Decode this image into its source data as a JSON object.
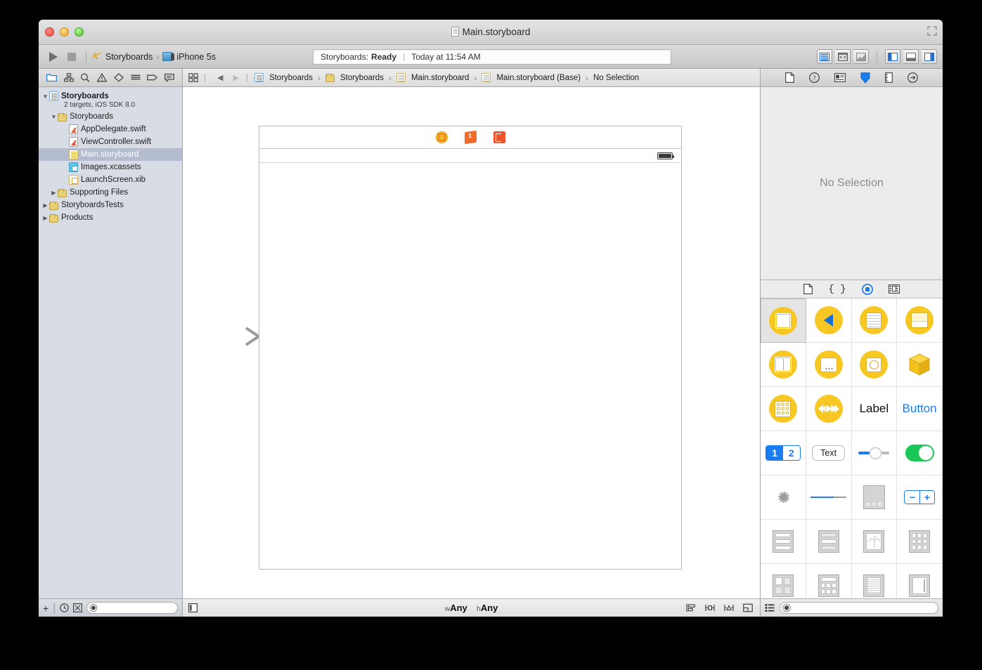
{
  "window": {
    "title": "Main.storyboard",
    "title_icon": "storyboard-file-icon"
  },
  "toolbar": {
    "run_label": "Run",
    "stop_label": "Stop",
    "scheme": {
      "project_name": "Storyboards",
      "destination": "iPhone 5s",
      "separator": "›"
    },
    "status": {
      "prefix": "Storyboards:",
      "state": "Ready",
      "divider": "|",
      "time": "Today at 11:54 AM"
    },
    "editor_buttons": [
      "standard-editor",
      "assistant-editor",
      "version-editor"
    ],
    "view_buttons": [
      "toggle-navigator",
      "toggle-debug-area",
      "toggle-utilities"
    ]
  },
  "navigator": {
    "tabs": [
      "project-navigator",
      "symbol-navigator",
      "find-navigator",
      "issue-navigator",
      "test-navigator",
      "debug-navigator",
      "breakpoint-navigator",
      "report-navigator"
    ],
    "tree": [
      {
        "label": "Storyboards",
        "sublabel": "2 targets, iOS SDK 8.0",
        "icon": "project-icon",
        "indent": 0,
        "disclosure": "open",
        "bold": true,
        "selected": false
      },
      {
        "label": "Storyboards",
        "icon": "folder-icon",
        "indent": 1,
        "disclosure": "open",
        "bold": false,
        "selected": false
      },
      {
        "label": "AppDelegate.swift",
        "icon": "swift-file-icon",
        "indent": 2,
        "disclosure": "none",
        "bold": false,
        "selected": false
      },
      {
        "label": "ViewController.swift",
        "icon": "swift-file-icon",
        "indent": 2,
        "disclosure": "none",
        "bold": false,
        "selected": false
      },
      {
        "label": "Main.storyboard",
        "icon": "storyboard-file-icon",
        "indent": 2,
        "disclosure": "none",
        "bold": false,
        "selected": true
      },
      {
        "label": "Images.xcassets",
        "icon": "assets-icon",
        "indent": 2,
        "disclosure": "none",
        "bold": false,
        "selected": false
      },
      {
        "label": "LaunchScreen.xib",
        "icon": "xib-file-icon",
        "indent": 2,
        "disclosure": "none",
        "bold": false,
        "selected": false
      },
      {
        "label": "Supporting Files",
        "icon": "folder-icon",
        "indent": 1,
        "disclosure": "closed",
        "bold": false,
        "selected": false
      },
      {
        "label": "StoryboardsTests",
        "icon": "folder-icon",
        "indent": 0,
        "disclosure": "closed",
        "bold": false,
        "selected": false
      },
      {
        "label": "Products",
        "icon": "folder-icon",
        "indent": 0,
        "disclosure": "closed",
        "bold": false,
        "selected": false
      }
    ],
    "bottom": {
      "add_label": "+",
      "recent_label": "recent-filter",
      "source_control_label": "source-control-filter",
      "filter_placeholder": ""
    }
  },
  "editor": {
    "jumpbar": {
      "related_items_label": "related-items",
      "back_label": "◀",
      "forward_label": "▶",
      "breadcrumbs": [
        {
          "label": "Storyboards",
          "icon": "project-icon"
        },
        {
          "label": "Storyboards",
          "icon": "folder-icon"
        },
        {
          "label": "Main.storyboard",
          "icon": "storyboard-file-icon"
        },
        {
          "label": "Main.storyboard (Base)",
          "icon": "storyboard-file-icon"
        },
        {
          "label": "No Selection",
          "icon": "none"
        }
      ],
      "separator": "›"
    },
    "canvas": {
      "scene_dock_icons": [
        "view-controller-icon",
        "first-responder-icon",
        "exit-icon"
      ],
      "entry_point": "storyboard-entry-point-arrow"
    },
    "bottom": {
      "document_outline_label": "document-outline-toggle",
      "size_class": {
        "width_prefix": "w",
        "width_value": "Any",
        "height_prefix": "h",
        "height_value": "Any"
      },
      "tools": [
        "align",
        "pin",
        "resolve-auto-layout-issues",
        "resizing-behavior"
      ]
    }
  },
  "utilities": {
    "inspector_tabs": [
      "file-inspector",
      "quick-help-inspector",
      "identity-inspector",
      "attributes-inspector",
      "size-inspector",
      "connections-inspector"
    ],
    "selected_inspector": "attributes-inspector",
    "empty_state": "No Selection",
    "library_tabs": [
      "file-template-library",
      "code-snippet-library",
      "object-library",
      "media-library"
    ],
    "selected_library": "object-library",
    "objects": [
      {
        "name": "View Controller",
        "icon": "view-controller-object",
        "selected": true
      },
      {
        "name": "Navigation Controller",
        "icon": "navigation-controller-object",
        "selected": false
      },
      {
        "name": "Table View Controller",
        "icon": "table-view-controller-object",
        "selected": false
      },
      {
        "name": "Tab Bar Controller",
        "icon": "tab-bar-controller-object",
        "selected": false
      },
      {
        "name": "Split View Controller",
        "icon": "split-view-controller-object",
        "selected": false
      },
      {
        "name": "Popover Controller",
        "icon": "popover-controller-object",
        "selected": false
      },
      {
        "name": "Page View Controller",
        "icon": "page-view-controller-object",
        "selected": false
      },
      {
        "name": "Object",
        "icon": "generic-object",
        "selected": false
      },
      {
        "name": "Collection View Controller",
        "icon": "collection-view-controller-object",
        "selected": false
      },
      {
        "name": "AV Player View Controller",
        "icon": "av-player-view-controller-object",
        "selected": false
      },
      {
        "name": "Label",
        "icon": "label-object",
        "label_text": "Label",
        "selected": false
      },
      {
        "name": "Button",
        "icon": "button-object",
        "label_text": "Button",
        "selected": false
      },
      {
        "name": "Segmented Control",
        "icon": "segmented-control-object",
        "seg1": "1",
        "seg2": "2",
        "selected": false
      },
      {
        "name": "Text Field",
        "icon": "text-field-object",
        "label_text": "Text",
        "selected": false
      },
      {
        "name": "Slider",
        "icon": "slider-object",
        "selected": false
      },
      {
        "name": "Switch",
        "icon": "switch-object",
        "selected": false
      },
      {
        "name": "Activity Indicator View",
        "icon": "activity-indicator-object",
        "selected": false
      },
      {
        "name": "Progress View",
        "icon": "progress-view-object",
        "selected": false
      },
      {
        "name": "Page Control",
        "icon": "page-control-object",
        "selected": false
      },
      {
        "name": "Stepper",
        "icon": "stepper-object",
        "minus": "−",
        "plus": "+",
        "selected": false
      },
      {
        "name": "Table View",
        "icon": "table-view-object",
        "selected": false
      },
      {
        "name": "Table View Cell",
        "icon": "table-view-cell-object",
        "selected": false
      },
      {
        "name": "Image View",
        "icon": "image-view-object",
        "selected": false
      },
      {
        "name": "Collection View",
        "icon": "collection-view-object",
        "selected": false
      },
      {
        "name": "Collection View Cell",
        "icon": "collection-view-cell-object",
        "selected": false
      },
      {
        "name": "Collection Reusable View",
        "icon": "collection-reusable-view-object",
        "selected": false
      },
      {
        "name": "Text View",
        "icon": "text-view-object",
        "selected": false
      },
      {
        "name": "Scroll View",
        "icon": "scroll-view-object",
        "selected": false
      }
    ],
    "bottom": {
      "view_mode_label": "library-view-mode",
      "filter_placeholder": ""
    }
  },
  "colors": {
    "accent_blue": "#1a7cf0",
    "library_yellow": "#f7c723",
    "switch_green": "#18c755",
    "selection_blue": "#b4bcd0",
    "scene_orange": "#f0542a"
  }
}
